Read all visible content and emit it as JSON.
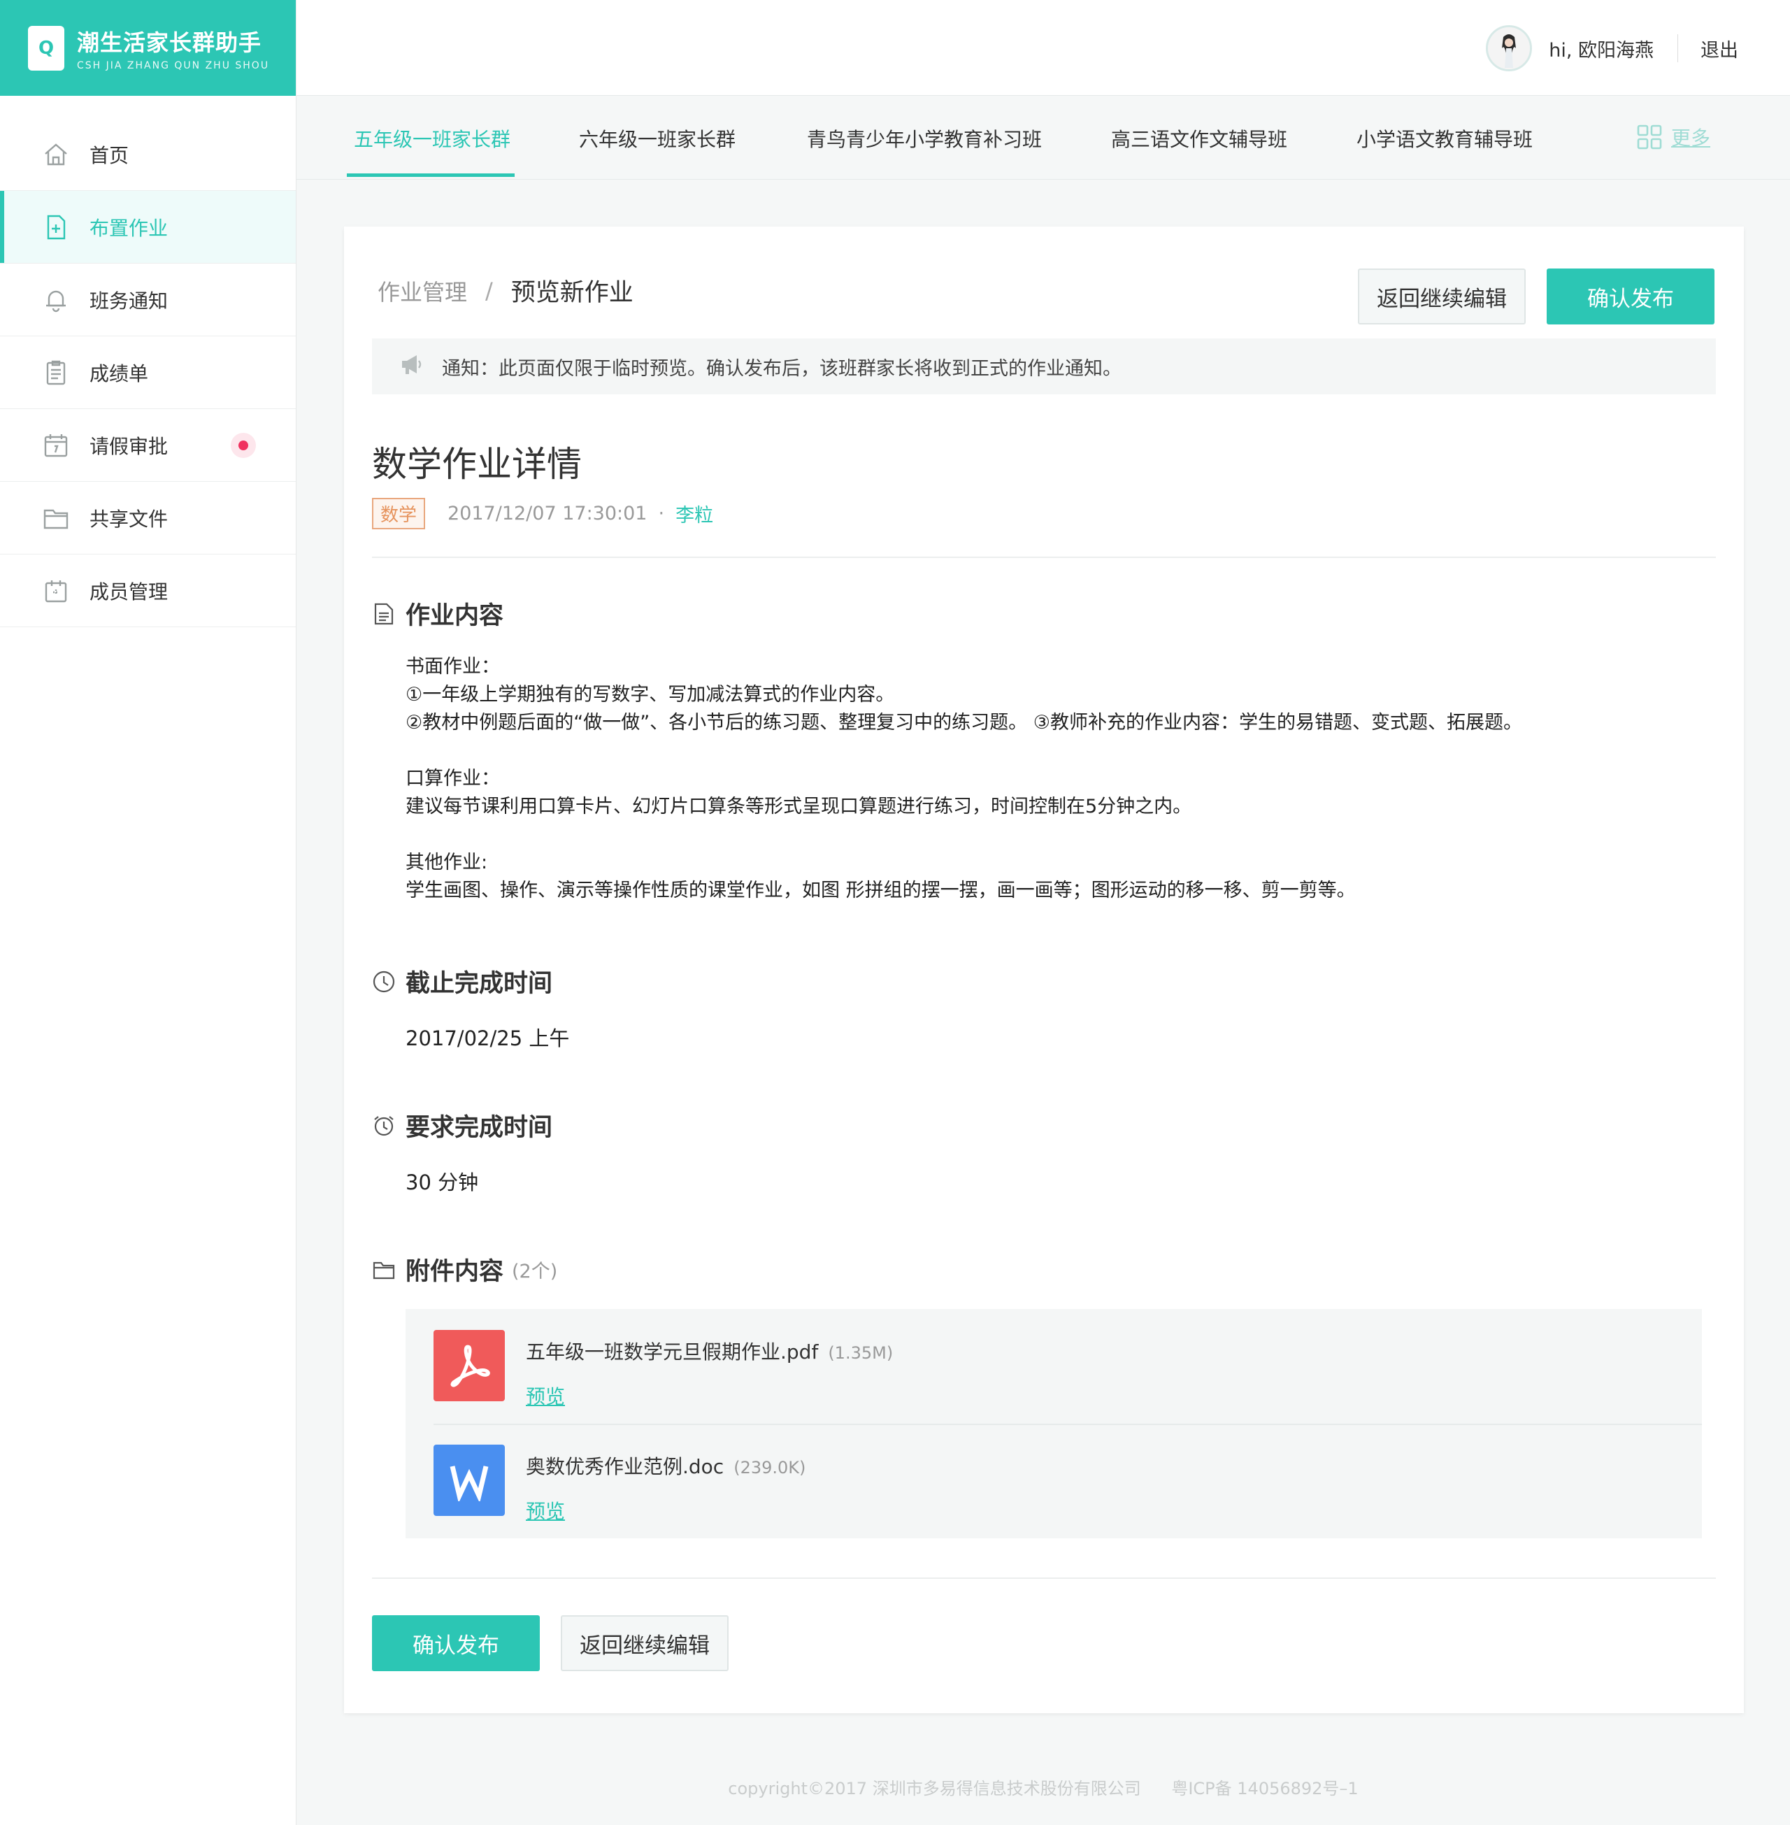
{
  "brand": {
    "logo_letter": "Q",
    "title": "潮生活家长群助手",
    "subtitle": "CSH JIA ZHANG QUN ZHU SHOU"
  },
  "sidebar": {
    "items": [
      {
        "label": "首页",
        "icon": "home-icon"
      },
      {
        "label": "布置作业",
        "icon": "assignment-icon",
        "active": true
      },
      {
        "label": "班务通知",
        "icon": "bell-icon"
      },
      {
        "label": "成绩单",
        "icon": "report-icon"
      },
      {
        "label": "请假审批",
        "icon": "calendar-icon",
        "badge": true
      },
      {
        "label": "共享文件",
        "icon": "folder-icon"
      },
      {
        "label": "成员管理",
        "icon": "members-icon"
      }
    ]
  },
  "header": {
    "greeting": "hi, 欧阳海燕",
    "logout": "退出"
  },
  "tabs": {
    "items": [
      "五年级一班家长群",
      "六年级一班家长群",
      "青鸟青少年小学教育补习班",
      "高三语文作文辅导班",
      "小学语文教育辅导班"
    ],
    "more": "更多"
  },
  "breadcrumb": {
    "parent": "作业管理",
    "separator": "/",
    "current": "预览新作业"
  },
  "buttons": {
    "back_edit": "返回继续编辑",
    "confirm": "确认发布"
  },
  "notice": "通知：此页面仅限于临时预览。确认发布后，该班群家长将收到正式的作业通知。",
  "detail": {
    "title": "数学作业详情",
    "subject": "数学",
    "datetime": "2017/12/07 17:30:01",
    "dot": "·",
    "author": "李粒"
  },
  "sections": {
    "content_title": "作业内容",
    "content_text": "书面作业：\n①一年级上学期独有的写数字、写加减法算式的作业内容。\n②教材中例题后面的“做一做”、各小节后的练习题、整理复习中的练习题。 ③教师补充的作业内容：学生的易错题、变式题、拓展题。\n\n口算作业：\n建议每节课利用口算卡片、幻灯片口算条等形式呈现口算题进行练习，时间控制在5分钟之内。\n\n其他作业:\n学生画图、操作、演示等操作性质的课堂作业，如图 形拼组的摆一摆，画一画等；图形运动的移一移、剪一剪等。",
    "deadline_title": "截止完成时间",
    "deadline_value": "2017/02/25 上午",
    "duration_title": "要求完成时间",
    "duration_value": "30 分钟",
    "attach_title": "附件内容",
    "attach_count": "(2个)"
  },
  "attachments": [
    {
      "name": "五年级一班数学元旦假期作业.pdf",
      "size": "(1.35M)",
      "link": "预览",
      "type": "pdf",
      "color": "#f05a5a"
    },
    {
      "name": "奥数优秀作业范例.doc",
      "size": "(239.0K)",
      "link": "预览",
      "type": "doc",
      "color": "#4a8ff0"
    }
  ],
  "footer": {
    "copyright": "copyright©2017 深圳市多易得信息技术股份有限公司",
    "icp": "粤ICP备 14056892号–1"
  },
  "colors": {
    "accent": "#2cc6b4",
    "badge": "#f0325f",
    "tag": "#e6935d"
  }
}
